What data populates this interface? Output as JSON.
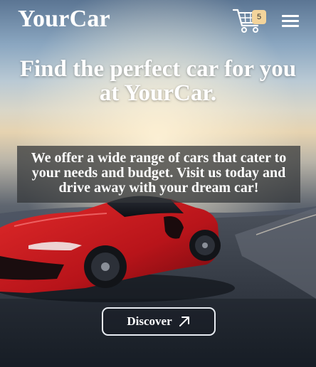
{
  "navbar": {
    "brand": "YourCar",
    "cart_count": "5",
    "cart_icon": "shopping-cart-icon",
    "menu_icon": "hamburger-menu-icon"
  },
  "hero": {
    "headline": "Find the perfect car for you at YourCar.",
    "description": "We offer a wide range of cars that cater to your needs and budget. Visit us today and drive away with your dream car!",
    "cta_label": "Discover",
    "cta_icon": "arrow-up-right-icon"
  },
  "colors": {
    "text": "#ffffff",
    "badge": "#f3d49b",
    "car_body": "#c8161b",
    "overlay": "#323438"
  }
}
